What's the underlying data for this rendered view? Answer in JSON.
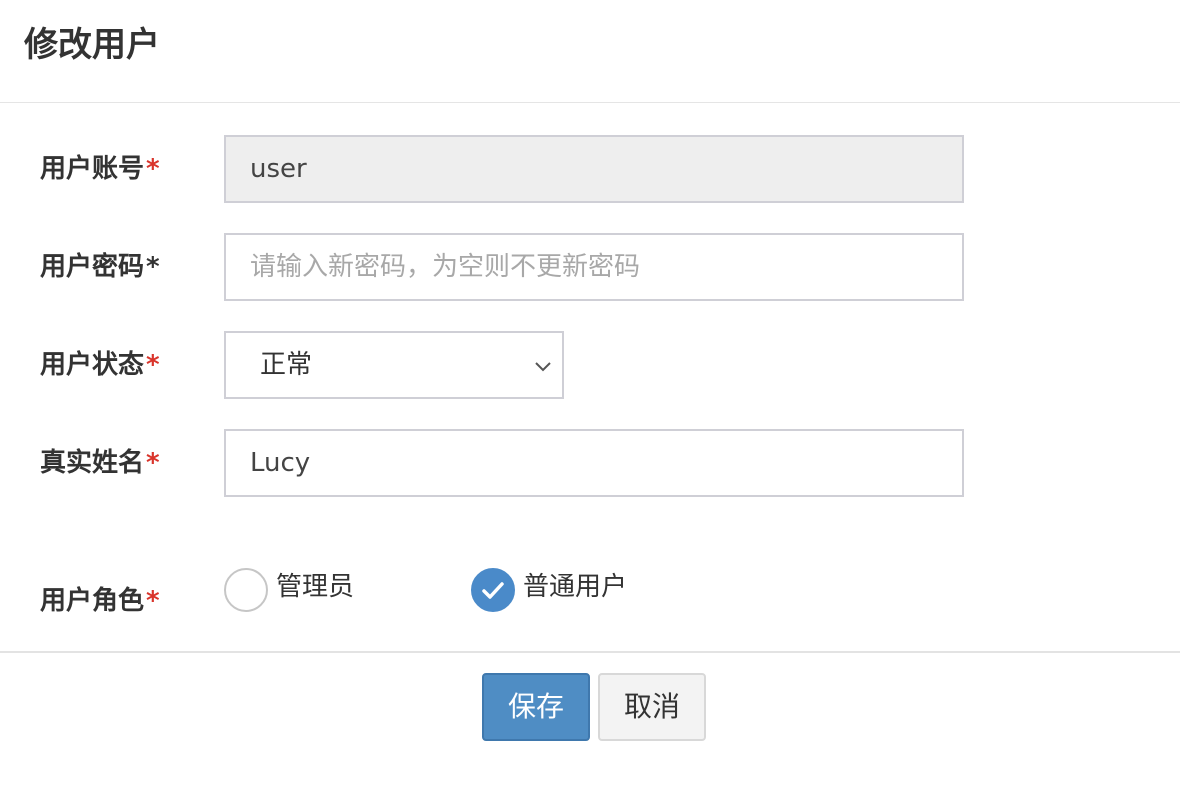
{
  "dialog": {
    "title": "修改用户"
  },
  "form": {
    "account": {
      "label": "用户账号",
      "required": "*",
      "value": "user"
    },
    "password": {
      "label": "用户密码",
      "required": "*",
      "placeholder": "请输入新密码，为空则不更新密码"
    },
    "status": {
      "label": "用户状态",
      "required": "*",
      "selected": "正常"
    },
    "real_name": {
      "label": "真实姓名",
      "required": "*",
      "value": "Lucy"
    },
    "role": {
      "label": "用户角色",
      "required": "*",
      "options": [
        {
          "label": "管理员",
          "checked": false
        },
        {
          "label": "普通用户",
          "checked": true
        }
      ]
    }
  },
  "footer": {
    "save_label": "保存",
    "cancel_label": "取消"
  },
  "colors": {
    "primary": "#4f8dc4",
    "required": "#d9342b",
    "radio_checked": "#4a8ac9"
  }
}
